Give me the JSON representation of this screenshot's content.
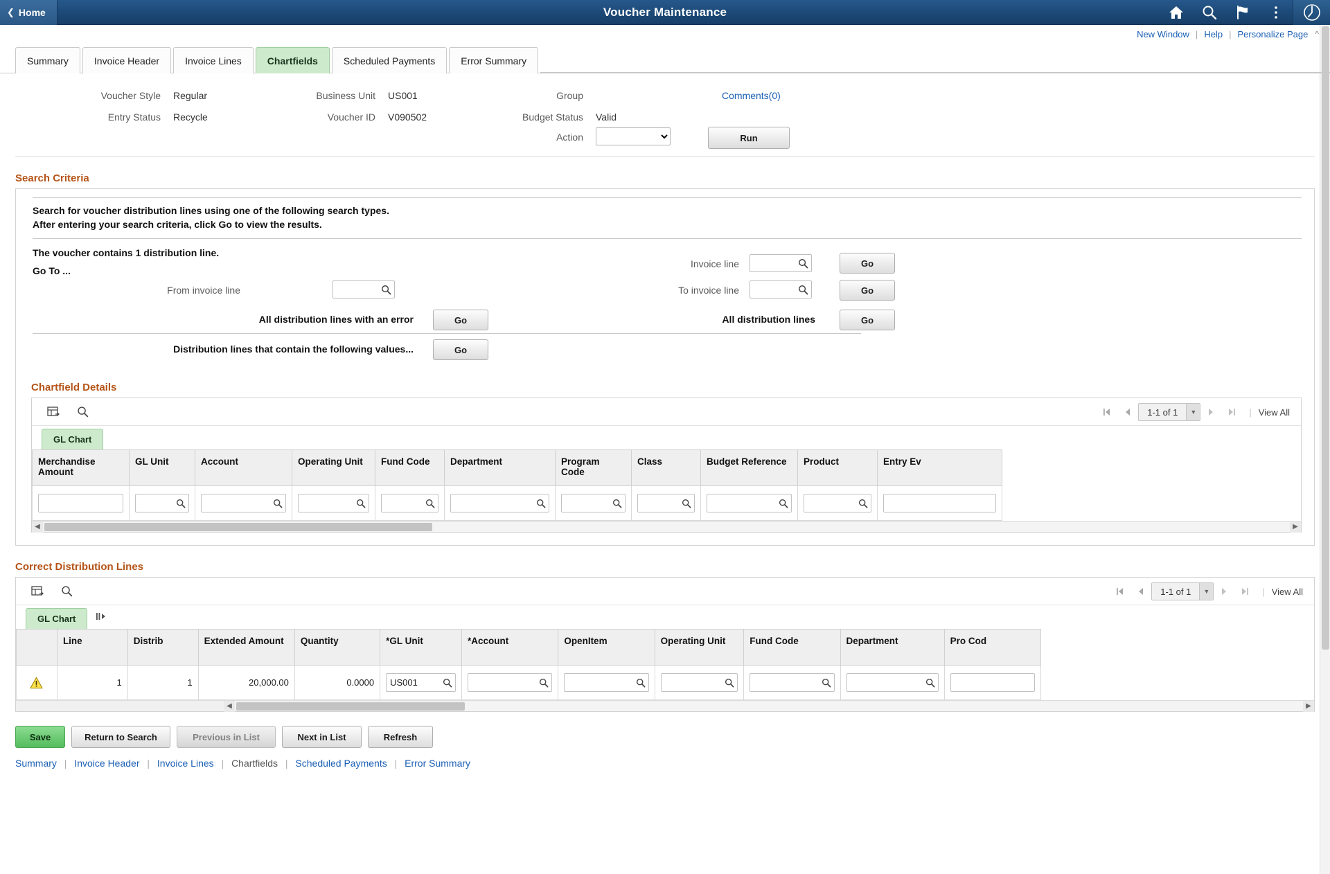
{
  "topbar": {
    "home_label": "Home",
    "title": "Voucher Maintenance",
    "icons": [
      "home-icon",
      "search-icon",
      "notification-flag-icon",
      "actions-menu-icon",
      "nav-bar-icon"
    ]
  },
  "linkbar": {
    "new_window": "New Window",
    "help": "Help",
    "personalize": "Personalize Page"
  },
  "tabs": [
    {
      "label": "Summary",
      "active": false
    },
    {
      "label": "Invoice Header",
      "active": false
    },
    {
      "label": "Invoice Lines",
      "active": false
    },
    {
      "label": "Chartfields",
      "active": true
    },
    {
      "label": "Scheduled Payments",
      "active": false
    },
    {
      "label": "Error Summary",
      "active": false
    }
  ],
  "header": {
    "voucher_style_label": "Voucher Style",
    "voucher_style_value": "Regular",
    "entry_status_label": "Entry Status",
    "entry_status_value": "Recycle",
    "business_unit_label": "Business Unit",
    "business_unit_value": "US001",
    "voucher_id_label": "Voucher ID",
    "voucher_id_value": "V090502",
    "group_label": "Group",
    "group_value": "",
    "budget_status_label": "Budget Status",
    "budget_status_value": "Valid",
    "action_label": "Action",
    "action_value": "",
    "action_options": [
      ""
    ],
    "run_label": "Run",
    "comments_link": "Comments(0)"
  },
  "search_criteria": {
    "title": "Search Criteria",
    "instruction_line1": "Search for voucher distribution lines using one of the following search types.",
    "instruction_line2": "After entering your search criteria, click Go to view the results.",
    "voucher_note": "The voucher contains 1 distribution line.",
    "go_to_label": "Go To ...",
    "from_invoice_line_label": "From invoice line",
    "from_invoice_line_value": "",
    "invoice_line_label": "Invoice line",
    "invoice_line_value": "",
    "to_invoice_line_label": "To invoice line",
    "to_invoice_line_value": "",
    "all_lines_error_label": "All distribution lines with an error",
    "all_distribution_lines_label": "All distribution lines",
    "contains_values_label": "Distribution lines that contain the following values...",
    "go_label": "Go"
  },
  "chartfield_details": {
    "title": "Chartfield Details",
    "toolbar_icons": [
      "grid-personalize-icon",
      "find-icon"
    ],
    "pager": {
      "text": "1-1 of 1",
      "view_all": "View All"
    },
    "gl_chart_tab": "GL Chart",
    "columns": [
      "Merchandise Amount",
      "GL Unit",
      "Account",
      "Operating Unit",
      "Fund Code",
      "Department",
      "Program Code",
      "Class",
      "Budget Reference",
      "Product",
      "Entry Ev"
    ],
    "row": {
      "merchandise_amount": "",
      "gl_unit": "",
      "account": "",
      "operating_unit": "",
      "fund_code": "",
      "department": "",
      "program_code": "",
      "class": "",
      "budget_reference": "",
      "product": "",
      "entry_event": ""
    }
  },
  "correct_distribution_lines": {
    "title": "Correct Distribution Lines",
    "toolbar_icons": [
      "grid-personalize-icon",
      "find-icon"
    ],
    "pager": {
      "text": "1-1 of 1",
      "view_all": "View All"
    },
    "gl_chart_tab": "GL Chart",
    "columns": [
      "",
      "Line",
      "Distrib",
      "Extended Amount",
      "Quantity",
      "*GL Unit",
      "*Account",
      "OpenItem",
      "Operating Unit",
      "Fund Code",
      "Department",
      "Pro Cod"
    ],
    "rows": [
      {
        "status": "warning-icon",
        "line": "1",
        "distrib": "1",
        "extended_amount": "20,000.00",
        "quantity": "0.0000",
        "gl_unit": "US001",
        "account": "",
        "openitem": "",
        "operating_unit": "",
        "fund_code": "",
        "department": "",
        "program_code": ""
      }
    ]
  },
  "footer": {
    "buttons": [
      {
        "label": "Save",
        "style": "primary",
        "disabled": false
      },
      {
        "label": "Return to Search",
        "style": "normal",
        "disabled": false
      },
      {
        "label": "Previous in List",
        "style": "normal",
        "disabled": true
      },
      {
        "label": "Next in List",
        "style": "normal",
        "disabled": false
      },
      {
        "label": "Refresh",
        "style": "normal",
        "disabled": false
      }
    ],
    "links": [
      {
        "label": "Summary",
        "current": false
      },
      {
        "label": "Invoice Header",
        "current": false
      },
      {
        "label": "Invoice Lines",
        "current": false
      },
      {
        "label": "Chartfields",
        "current": true
      },
      {
        "label": "Scheduled Payments",
        "current": false
      },
      {
        "label": "Error Summary",
        "current": false
      }
    ]
  },
  "colors": {
    "header_blue": "#1d4a78",
    "accent_orange": "#b55417",
    "active_tab_green": "#cdeacd",
    "link_blue": "#1a5fb4",
    "save_green": "#6cca74"
  }
}
